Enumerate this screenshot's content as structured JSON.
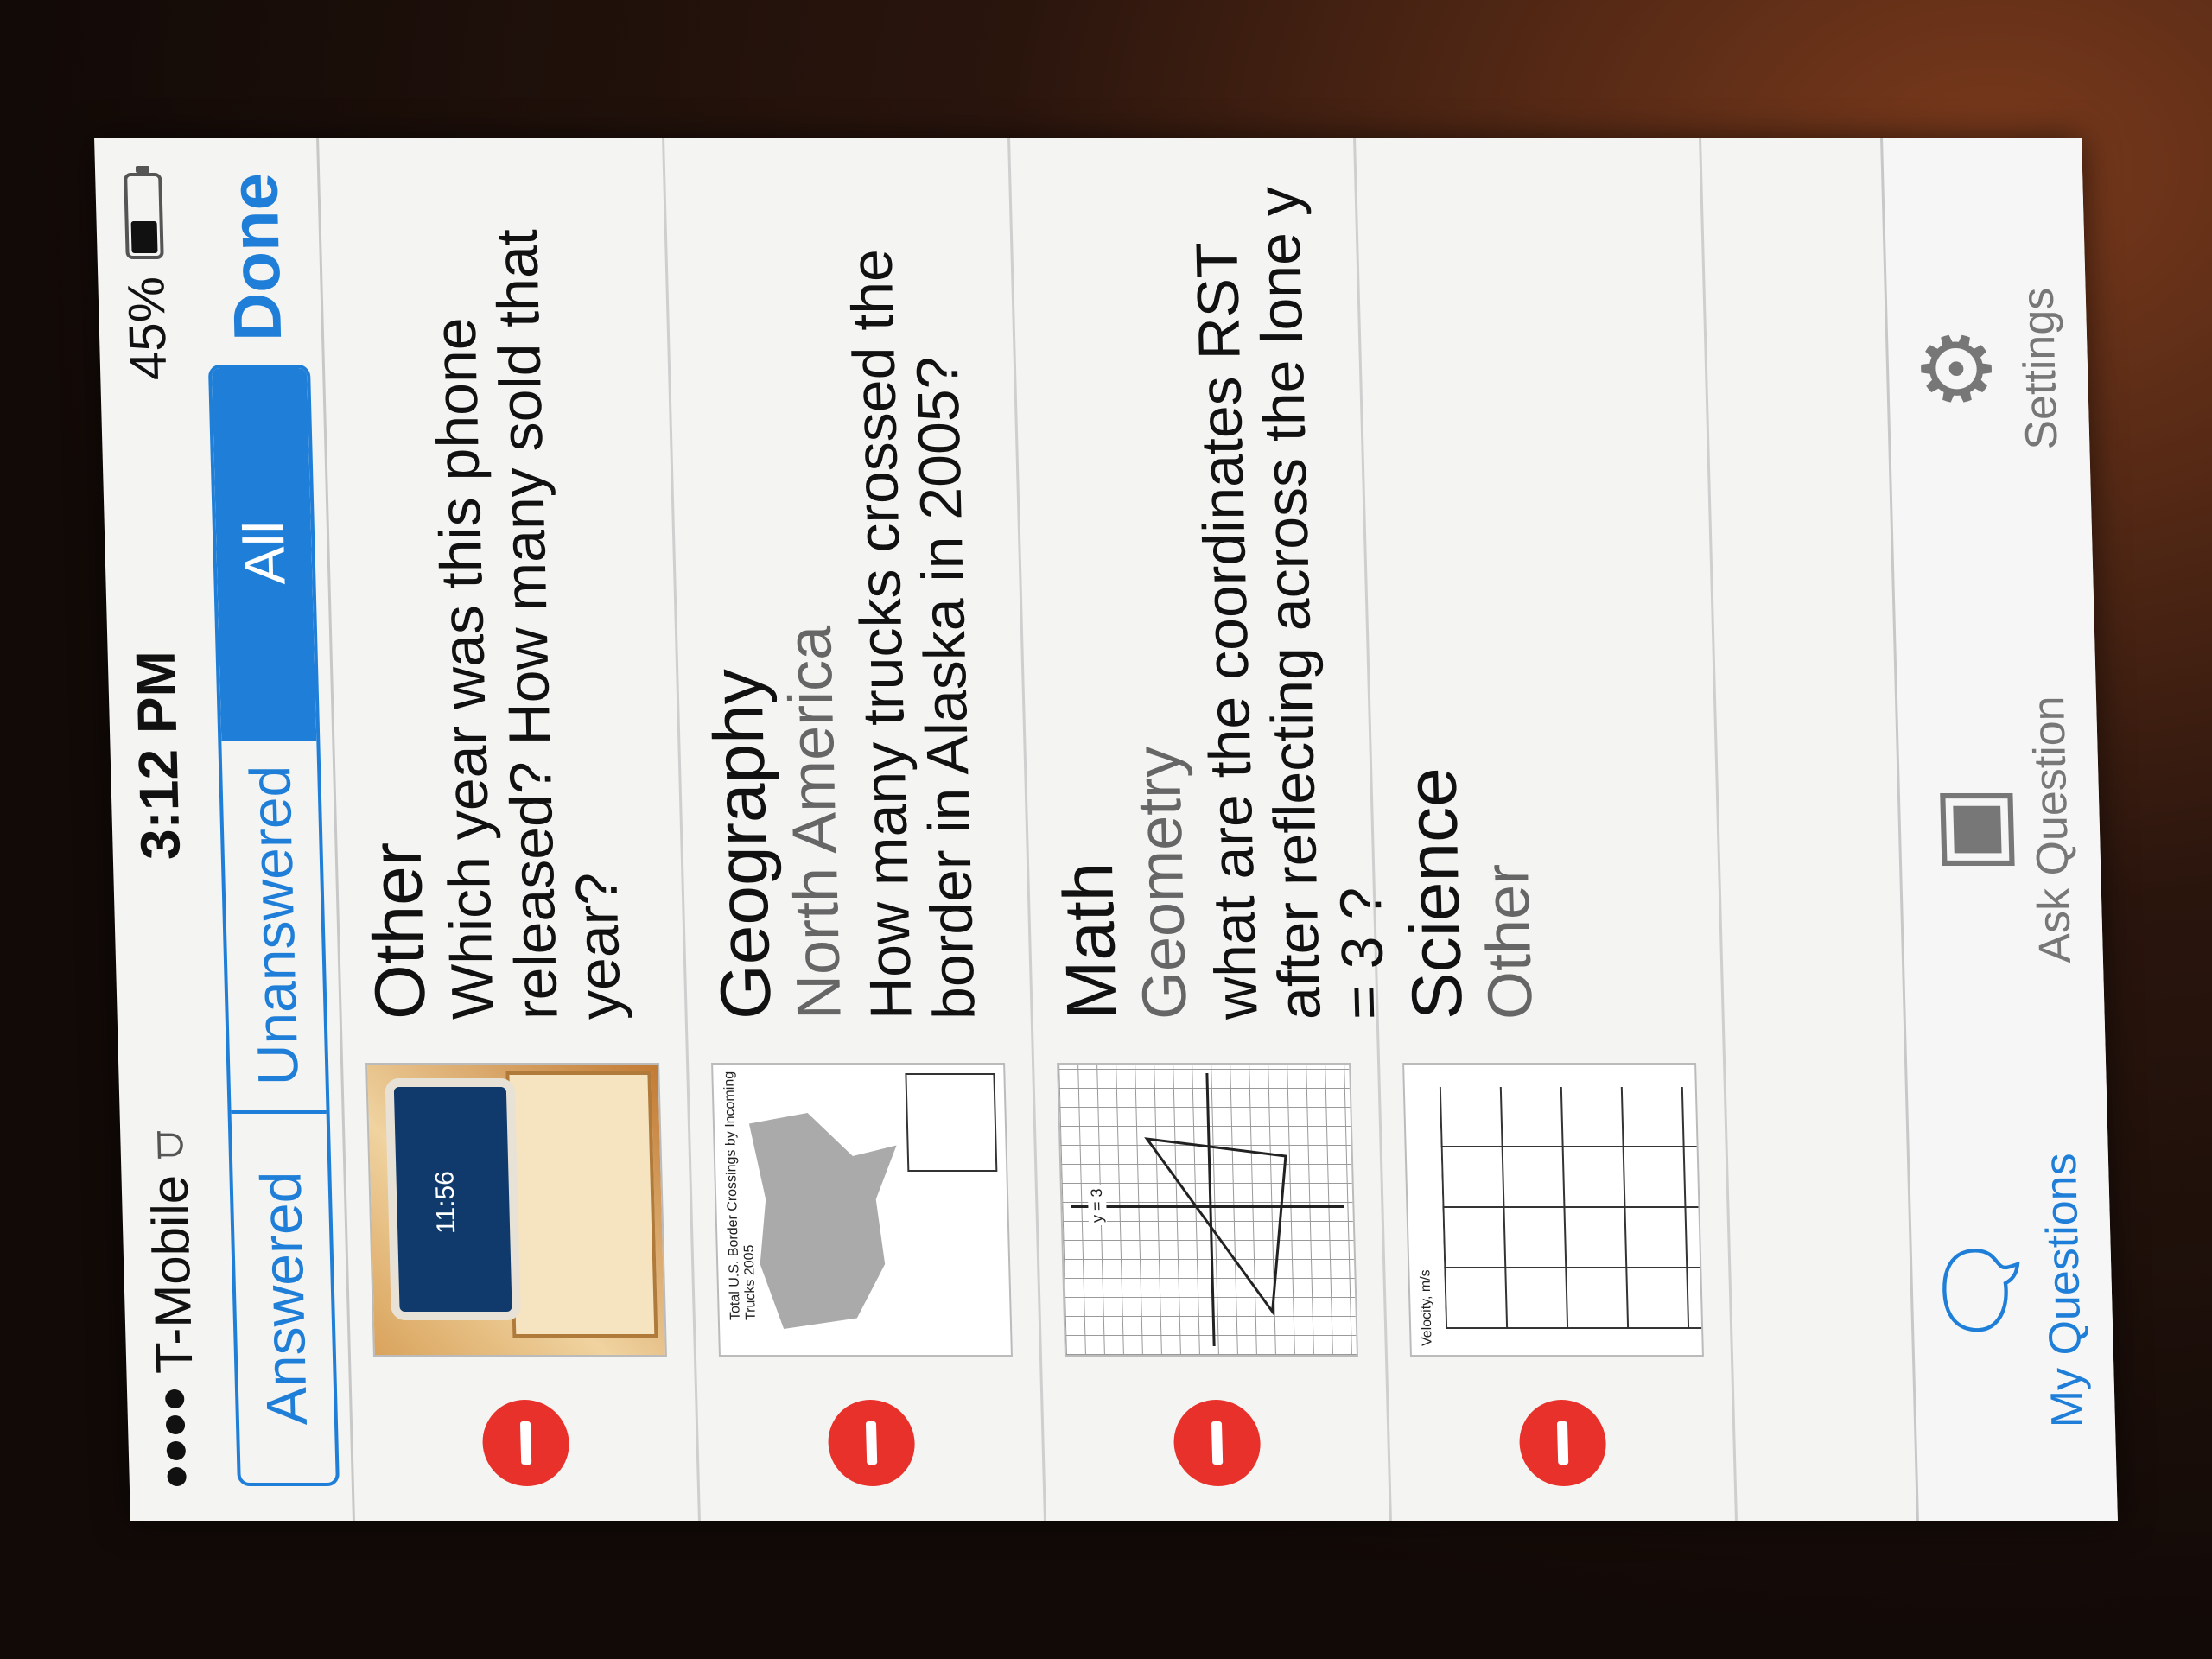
{
  "status_bar": {
    "carrier": "T-Mobile",
    "time": "3:12 PM",
    "battery_percent": "45%",
    "wifi_icon": "wifi-icon",
    "signal_icon": "signal-dots-icon"
  },
  "nav": {
    "segments": [
      {
        "label": "Answered",
        "selected": false
      },
      {
        "label": "Unanswered",
        "selected": false
      },
      {
        "label": "All",
        "selected": true
      }
    ],
    "done_label": "Done"
  },
  "questions": [
    {
      "subject": "Other",
      "topic": "",
      "question": "Which year was this phone released? How many sold that year?",
      "thumb_text": "11:56"
    },
    {
      "subject": "Geography",
      "topic": "North America",
      "question": "How many trucks crossed the border in Alaska in 2005?",
      "thumb_text": "Total U.S. Border Crossings by Incoming Trucks 2005"
    },
    {
      "subject": "Math",
      "topic": "Geometry",
      "question": "what are the coordinates RST after reflecting across the lone y = 3 ?",
      "thumb_text": "y = 3"
    },
    {
      "subject": "Science",
      "topic": "Other",
      "question": "",
      "thumb_text": "Velocity, m/s"
    }
  ],
  "tab_bar": {
    "tabs": [
      {
        "label": "My Questions",
        "icon": "chat-bubbles-icon",
        "active": true
      },
      {
        "label": "Ask Question",
        "icon": "camera-icon",
        "active": false
      },
      {
        "label": "Settings",
        "icon": "gear-icon",
        "active": false
      }
    ]
  },
  "colors": {
    "accent": "#1f7fd8",
    "delete": "#e8312a"
  }
}
